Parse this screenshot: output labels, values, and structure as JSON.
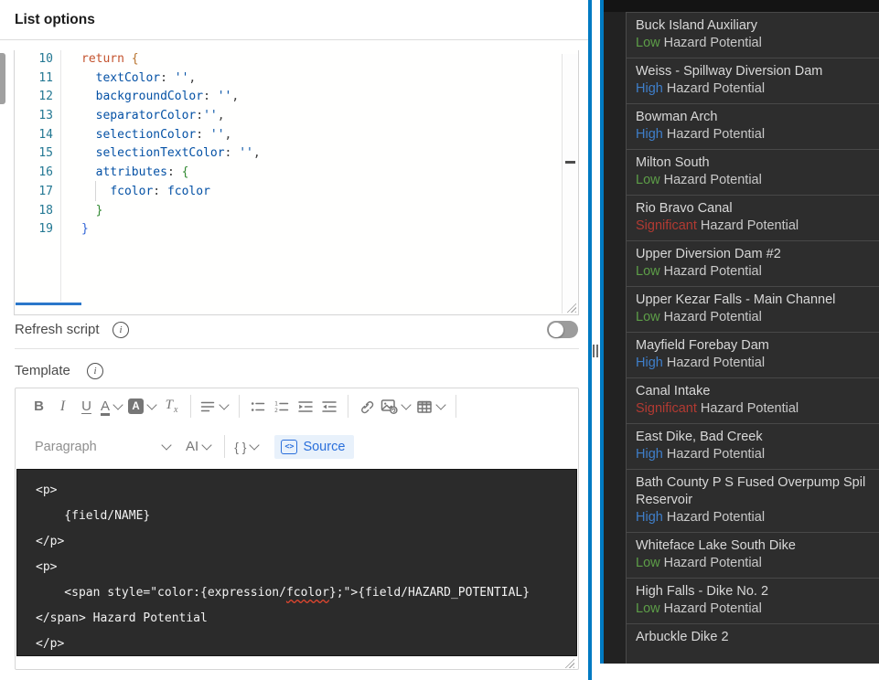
{
  "panel": {
    "title": "List options"
  },
  "code_editor": {
    "lines": [
      {
        "num": "10",
        "segs": [
          {
            "t": "return",
            "c": "kw"
          },
          {
            "t": " ",
            "c": "pl"
          },
          {
            "t": "{",
            "c": "b1"
          }
        ]
      },
      {
        "num": "11",
        "segs": [
          {
            "t": "  ",
            "c": "pl"
          },
          {
            "t": "textColor",
            "c": "id"
          },
          {
            "t": ": ",
            "c": "pl"
          },
          {
            "t": "''",
            "c": "st"
          },
          {
            "t": ",",
            "c": "pl"
          }
        ]
      },
      {
        "num": "12",
        "segs": [
          {
            "t": "  ",
            "c": "pl"
          },
          {
            "t": "backgroundColor",
            "c": "id"
          },
          {
            "t": ": ",
            "c": "pl"
          },
          {
            "t": "''",
            "c": "st"
          },
          {
            "t": ",",
            "c": "pl"
          }
        ]
      },
      {
        "num": "13",
        "segs": [
          {
            "t": "  ",
            "c": "pl"
          },
          {
            "t": "separatorColor",
            "c": "id"
          },
          {
            "t": ":",
            "c": "pl"
          },
          {
            "t": "''",
            "c": "st"
          },
          {
            "t": ",",
            "c": "pl"
          }
        ]
      },
      {
        "num": "14",
        "segs": [
          {
            "t": "  ",
            "c": "pl"
          },
          {
            "t": "selectionColor",
            "c": "id"
          },
          {
            "t": ": ",
            "c": "pl"
          },
          {
            "t": "''",
            "c": "st"
          },
          {
            "t": ",",
            "c": "pl"
          }
        ]
      },
      {
        "num": "15",
        "segs": [
          {
            "t": "  ",
            "c": "pl"
          },
          {
            "t": "selectionTextColor",
            "c": "id"
          },
          {
            "t": ": ",
            "c": "pl"
          },
          {
            "t": "''",
            "c": "st"
          },
          {
            "t": ",",
            "c": "pl"
          }
        ]
      },
      {
        "num": "16",
        "segs": [
          {
            "t": "  ",
            "c": "pl"
          },
          {
            "t": "attributes",
            "c": "id"
          },
          {
            "t": ": ",
            "c": "pl"
          },
          {
            "t": "{",
            "c": "b2"
          }
        ]
      },
      {
        "num": "17",
        "segs": [
          {
            "t": "    ",
            "c": "pl"
          },
          {
            "t": "fcolor",
            "c": "id"
          },
          {
            "t": ": ",
            "c": "pl"
          },
          {
            "t": "fcolor",
            "c": "id"
          }
        ]
      },
      {
        "num": "18",
        "segs": [
          {
            "t": "  ",
            "c": "pl"
          },
          {
            "t": "}",
            "c": "b2"
          }
        ]
      },
      {
        "num": "19",
        "segs": [
          {
            "t": "}",
            "c": "b3"
          }
        ]
      }
    ]
  },
  "refresh": {
    "label": "Refresh script",
    "toggle_on": false
  },
  "template": {
    "label": "Template"
  },
  "toolbar": {
    "bold": "B",
    "italic": "I",
    "underline": "U",
    "font_color": "A",
    "highlight": "A",
    "remove_format_t": "T",
    "remove_format_x": "x",
    "paragraph": "Paragraph",
    "ai": "AI",
    "braces": "{ }",
    "source_label": "Source",
    "source_icon_glyph": "<>"
  },
  "source_view": {
    "lines": [
      {
        "segs": [
          {
            "t": "<p>"
          }
        ]
      },
      {
        "segs": [
          {
            "t": "    {field/NAME}"
          }
        ]
      },
      {
        "segs": [
          {
            "t": "</p>"
          }
        ]
      },
      {
        "segs": [
          {
            "t": "<p>"
          }
        ]
      },
      {
        "segs": [
          {
            "t": "    <span style=\"color:{expression/"
          },
          {
            "t": "fcolor",
            "misspell": true
          },
          {
            "t": "};\">{field/HAZARD_POTENTIAL}"
          }
        ]
      },
      {
        "segs": [
          {
            "t": "</span> Hazard Potential"
          }
        ]
      },
      {
        "segs": [
          {
            "t": "</p>"
          }
        ]
      }
    ]
  },
  "feature_list": {
    "hazard_suffix": " Hazard Potential",
    "level_colors": {
      "Low": "#5d9e48",
      "High": "#3f7fca",
      "Significant": "#b23a32"
    },
    "items": [
      {
        "name": "Buck Island Auxiliary",
        "level": "Low"
      },
      {
        "name": "Weiss - Spillway Diversion Dam",
        "level": "High"
      },
      {
        "name": "Bowman Arch",
        "level": "High"
      },
      {
        "name": "Milton South",
        "level": "Low"
      },
      {
        "name": "Rio Bravo Canal",
        "level": "Significant"
      },
      {
        "name": "Upper Diversion Dam #2",
        "level": "Low"
      },
      {
        "name": "Upper Kezar Falls - Main Channel",
        "level": "Low"
      },
      {
        "name": "Mayfield Forebay Dam",
        "level": "High"
      },
      {
        "name": "Canal Intake",
        "level": "Significant"
      },
      {
        "name": "East Dike, Bad Creek",
        "level": "High"
      },
      {
        "name": "Bath County P S Fused Overpump Spil\nReservoir",
        "level": "High"
      },
      {
        "name": "Whiteface Lake South Dike",
        "level": "Low"
      },
      {
        "name": "High Falls - Dike No. 2",
        "level": "Low"
      },
      {
        "name": "Arbuckle Dike 2",
        "level": null
      }
    ]
  },
  "colors": {
    "accent_blue": "#007ac2",
    "editor_dark_bg": "#2b2b2b",
    "line_number": "#237893"
  }
}
